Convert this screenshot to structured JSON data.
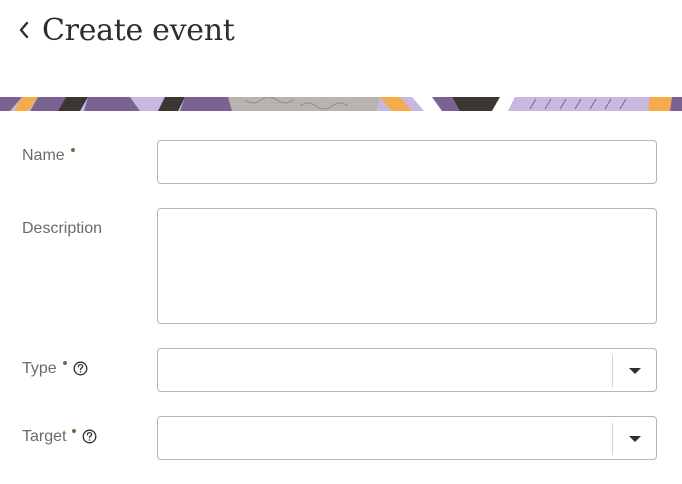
{
  "header": {
    "title": "Create event",
    "back_icon": "chevron-left-icon"
  },
  "banner": {
    "colors": [
      "#7b6391",
      "#f5ab4a",
      "#c8b8df",
      "#3a3634",
      "#b7b3ad",
      "#ffffff"
    ]
  },
  "form": {
    "name": {
      "label": "Name",
      "required": true,
      "value": "",
      "placeholder": ""
    },
    "description": {
      "label": "Description",
      "required": false,
      "value": "",
      "placeholder": ""
    },
    "type": {
      "label": "Type",
      "required": true,
      "help_icon": "question-circle-icon",
      "selected": "",
      "dropdown_icon": "caret-down-icon"
    },
    "target": {
      "label": "Target",
      "required": true,
      "help_icon": "question-circle-icon",
      "selected": "",
      "dropdown_icon": "caret-down-icon"
    }
  },
  "colors": {
    "required_indicator": "#5e7a3e",
    "label_text": "#6f6a66",
    "input_border": "#b9b5b1",
    "title_text": "#312d2a"
  }
}
